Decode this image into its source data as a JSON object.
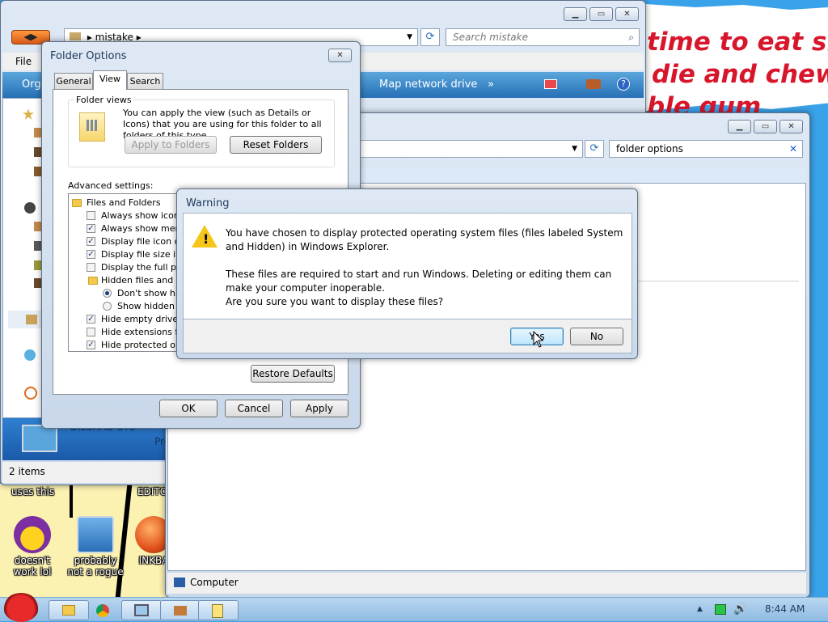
{
  "desktop": {
    "wallpaper_lines": [
      "time to eat shit",
      "die and chew",
      "ble gum"
    ],
    "top_labels": [
      "uses this",
      "EDITO"
    ],
    "icons": [
      {
        "label_line1": "doesn't",
        "label_line2": "work lol",
        "icon": "yahoo-messenger-icon"
      },
      {
        "label_line1": "probably",
        "label_line2": "not a rogue",
        "icon": "monitor-gears-icon"
      },
      {
        "label_line1": "INKBA",
        "label_line2": "",
        "icon": "orange-ball-icon"
      }
    ]
  },
  "explorer_back": {
    "breadcrumb": "mistake",
    "search_placeholder": "Search mistake",
    "menu_file": "File",
    "toolbar_organize": "Org",
    "toolbar_map": "Map network drive",
    "toolbar_more": "»",
    "status_items": "2 items",
    "computer_name": "DILSHAD-SYS",
    "computer_extra": "Pro"
  },
  "explorer_front": {
    "search_value": "folder options",
    "status_computer": "Computer"
  },
  "folder_options": {
    "title": "Folder Options",
    "tabs": [
      "General",
      "View",
      "Search"
    ],
    "folder_views_label": "Folder views",
    "folder_views_text": "You can apply the view (such as Details or Icons) that you are using for this folder to all folders of this type.",
    "apply_to_folders": "Apply to Folders",
    "reset_folders": "Reset Folders",
    "advanced_label": "Advanced settings:",
    "tree": [
      {
        "type": "folder",
        "label": "Files and Folders"
      },
      {
        "type": "check",
        "checked": false,
        "label": "Always show icons, never thumbnails"
      },
      {
        "type": "check",
        "checked": true,
        "label": "Always show menus"
      },
      {
        "type": "check",
        "checked": true,
        "label": "Display file icon on thumbnails"
      },
      {
        "type": "check",
        "checked": true,
        "label": "Display file size information in folder tips"
      },
      {
        "type": "check",
        "checked": false,
        "label": "Display the full path in the title bar"
      },
      {
        "type": "folder2",
        "label": "Hidden files and folders"
      },
      {
        "type": "radio",
        "checked": true,
        "label": "Don't show hidden files, folders, or drives"
      },
      {
        "type": "radio",
        "checked": false,
        "label": "Show hidden files, folders, and drives"
      },
      {
        "type": "check",
        "checked": true,
        "label": "Hide empty drives in the Computer folder"
      },
      {
        "type": "check",
        "checked": false,
        "label": "Hide extensions for known file types"
      },
      {
        "type": "check",
        "checked": true,
        "label": "Hide protected operating system files"
      }
    ],
    "restore_defaults": "Restore Defaults",
    "ok": "OK",
    "cancel": "Cancel",
    "apply": "Apply"
  },
  "warning": {
    "title": "Warning",
    "line1": "You have chosen to display protected operating system files (files labeled System",
    "line2": "and Hidden) in Windows Explorer.",
    "line3": "These files are required to start and run Windows. Deleting or editing them can",
    "line4": "make your computer inoperable.",
    "line5": "Are you sure you want to display these files?",
    "yes": "Yes",
    "no": "No"
  },
  "taskbar": {
    "clock": "8:44 AM"
  }
}
